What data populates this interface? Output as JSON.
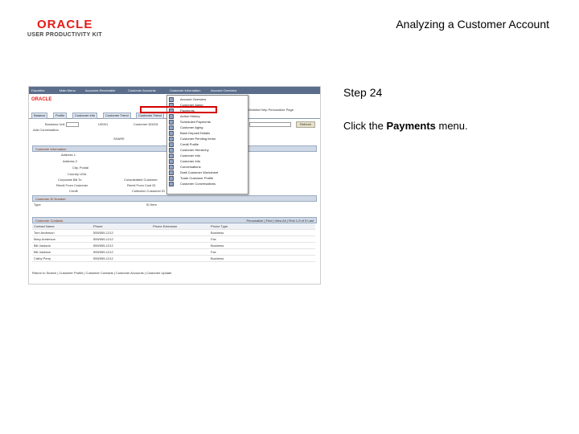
{
  "logo": {
    "brand": "ORACLE",
    "product": "USER PRODUCTIVITY KIT"
  },
  "slide": {
    "title": "Analyzing a Customer Account",
    "step": "Step 24",
    "instruction_prefix": "Click the ",
    "instruction_bold": "Payments",
    "instruction_suffix": " menu."
  },
  "shot": {
    "topbar": [
      "Favorites",
      "Main Menu",
      "Accounts Receivable",
      "Customer Accounts",
      "Customer Information",
      "Account Overview"
    ],
    "logo": "ORACLE",
    "header_links": "Home | Worklist | Add to Favorites | Sign out",
    "header_links2": "Worklist  Help  Personalize Page",
    "tabs": [
      "Balance",
      "Profile",
      "Customer Info",
      "Customer Trend",
      "Customer Trend",
      "Profile"
    ],
    "fields": {
      "unit_label": "Business Unit",
      "unit_value": "US001",
      "customer_label": "Customer ID",
      "customer_value": "1001",
      "add_conv": "Add Conversation",
      "relationship": "Relationship",
      "go": "Refresh",
      "setid": "SHARE"
    },
    "customer_info_title": "Customer Information",
    "address_rows": [
      "Address 1",
      "Address 2",
      "City, Postal",
      "Country  USA",
      "Corporate Bill To",
      "Remit From Customer",
      "Credit"
    ],
    "right_labels": [
      "Consolidated Customer",
      "Remit From Cust ID",
      "Collection Customer ID"
    ],
    "customer_id_title": "Customer ID Number",
    "customer_id_cols": [
      "Type",
      "ID Item"
    ],
    "contacts_title": "Customer Contacts",
    "contacts_nav": "Personalize | Find | View All |  First  1-5 of 5  Last",
    "contacts_cols": [
      "Contact Name",
      "Phone",
      "Phone Extension",
      "Phone Type"
    ],
    "contacts": [
      [
        "Tom Anderson",
        "555/555-1212",
        "",
        "Business"
      ],
      [
        "Mary Anderson",
        "555/555-1212",
        "",
        "Fax"
      ],
      [
        "Bill Jackson",
        "555/555-1212",
        "",
        "Business"
      ],
      [
        "Bill Jackson",
        "555/555-1212",
        "",
        "Fax"
      ],
      [
        "Cathy Perry",
        "555/555-1212",
        "",
        "Business"
      ]
    ],
    "bottom_links": "Return to Search | Customer Profile | Customer Contacts | Customer Accounts | Customer Update",
    "dropdown": [
      "Account Overview",
      "Customer Aging",
      "Payments",
      "Action History",
      "Scheduled Payments",
      "Customer Aging",
      "Bank Deposit Details",
      "Customer Pending Items",
      "Credit Profile",
      "Customer Hierarchy",
      "Customer Info",
      "Customer Info",
      "Conversations",
      "Draft Customer Worksheet",
      "Trade Customer Profile",
      "Customer Conversations"
    ]
  }
}
